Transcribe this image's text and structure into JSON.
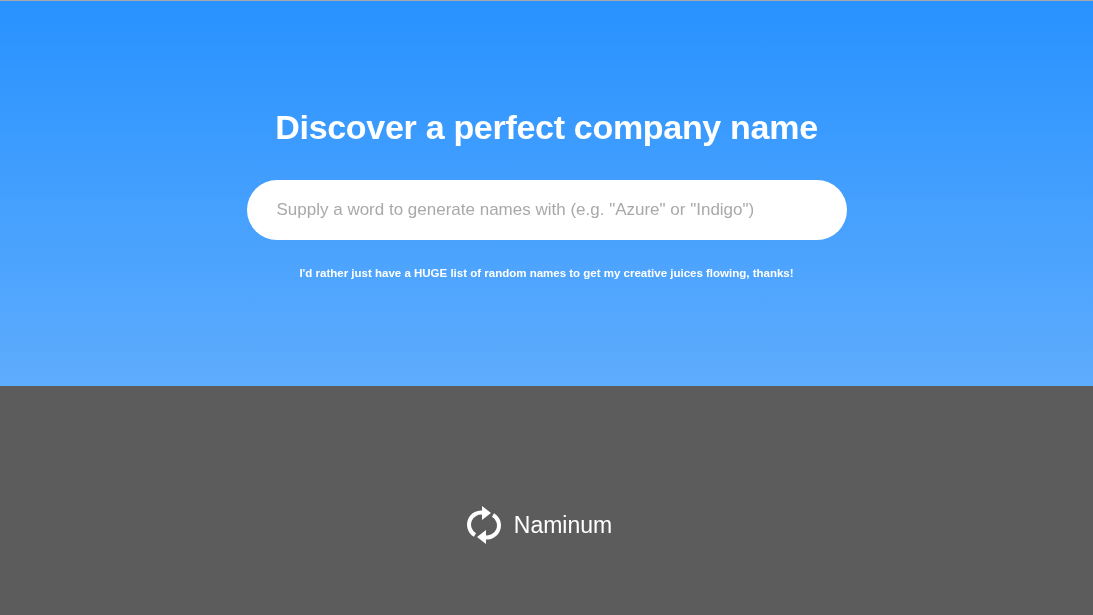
{
  "hero": {
    "title": "Discover a perfect company name",
    "search": {
      "placeholder": "Supply a word to generate names with (e.g. \"Azure\" or \"Indigo\")"
    },
    "random_link": "I'd rather just have a HUGE list of random names to get my creative juices flowing, thanks!"
  },
  "footer": {
    "brand": "Naminum"
  }
}
